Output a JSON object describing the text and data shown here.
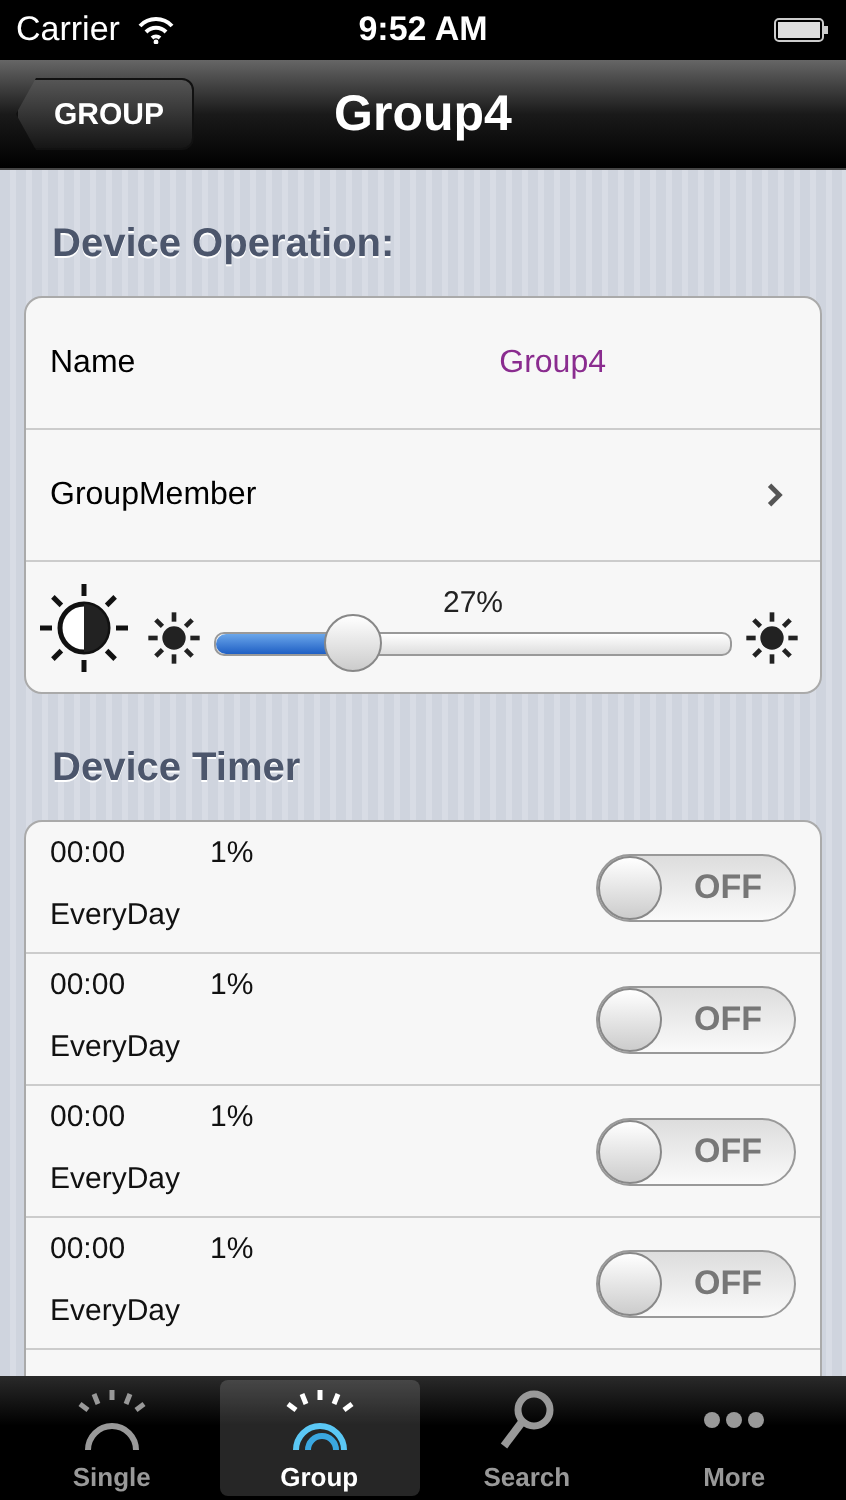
{
  "status_bar": {
    "carrier": "Carrier",
    "time": "9:52 AM"
  },
  "nav_bar": {
    "back": "GROUP",
    "title": "Group4"
  },
  "operation": {
    "header": "Device Operation:",
    "name_label": "Name",
    "name_value": "Group4",
    "member_label": "GroupMember",
    "brightness": {
      "level": 0.27,
      "reading": "27%"
    }
  },
  "timer": {
    "header": "Device Timer",
    "rows": [
      {
        "time": "00:00",
        "percent": "1%",
        "repeat": "EveryDay",
        "on": false,
        "state_label": "OFF"
      },
      {
        "time": "00:00",
        "percent": "1%",
        "repeat": "EveryDay",
        "on": false,
        "state_label": "OFF"
      },
      {
        "time": "00:00",
        "percent": "1%",
        "repeat": "EveryDay",
        "on": false,
        "state_label": "OFF"
      },
      {
        "time": "00:00",
        "percent": "1%",
        "repeat": "EveryDay",
        "on": false,
        "state_label": "OFF"
      }
    ]
  },
  "tab_bar": [
    {
      "label": "Single",
      "kind": "knob",
      "selected": false
    },
    {
      "label": "Group",
      "kind": "knob",
      "selected": true
    },
    {
      "label": "Search",
      "kind": "search",
      "selected": false
    },
    {
      "label": "More",
      "kind": "more",
      "selected": false
    }
  ]
}
